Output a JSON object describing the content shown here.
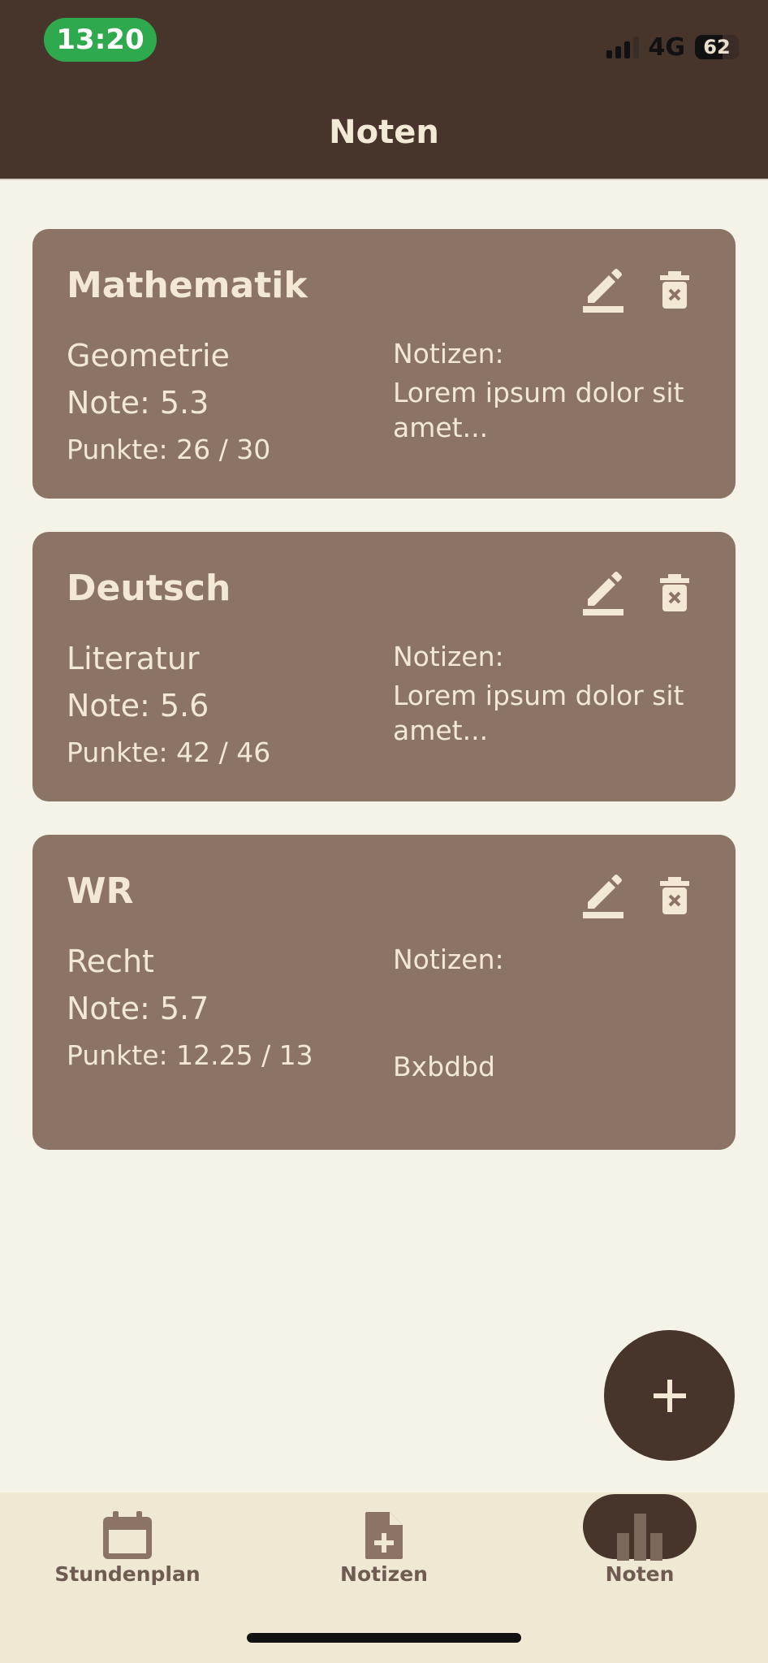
{
  "status_bar": {
    "time": "13:20",
    "network": "4G",
    "battery": "62"
  },
  "header": {
    "title": "Noten"
  },
  "grades": [
    {
      "subject": "Mathematik",
      "topic": "Geometrie",
      "note": "Note: 5.3",
      "points": "Punkte: 26 / 30",
      "notes_label": "Notizen:",
      "notes_text": "Lorem ipsum dolor sit amet..."
    },
    {
      "subject": "Deutsch",
      "topic": "Literatur",
      "note": "Note: 5.6",
      "points": "Punkte: 42 / 46",
      "notes_label": "Notizen:",
      "notes_text": "Lorem ipsum dolor sit amet..."
    },
    {
      "subject": "WR",
      "topic": "Recht",
      "note": "Note: 5.7",
      "points": "Punkte: 12.25 / 13",
      "notes_label": "Notizen:",
      "notes_text": "Bxbdbd"
    }
  ],
  "fab": {
    "icon": "plus-icon"
  },
  "bottom_nav": {
    "items": [
      {
        "label": "Stundenplan",
        "icon": "calendar-icon",
        "active": false
      },
      {
        "label": "Notizen",
        "icon": "note-add-icon",
        "active": false
      },
      {
        "label": "Noten",
        "icon": "bar-chart-icon",
        "active": true
      }
    ]
  },
  "colors": {
    "header_bg": "#47342B",
    "card_bg": "#8B7466",
    "page_bg": "#F5F2E8",
    "card_text": "#F2E8D3",
    "nav_bg": "#EFE8D3",
    "time_pill": "#2FA94D"
  }
}
